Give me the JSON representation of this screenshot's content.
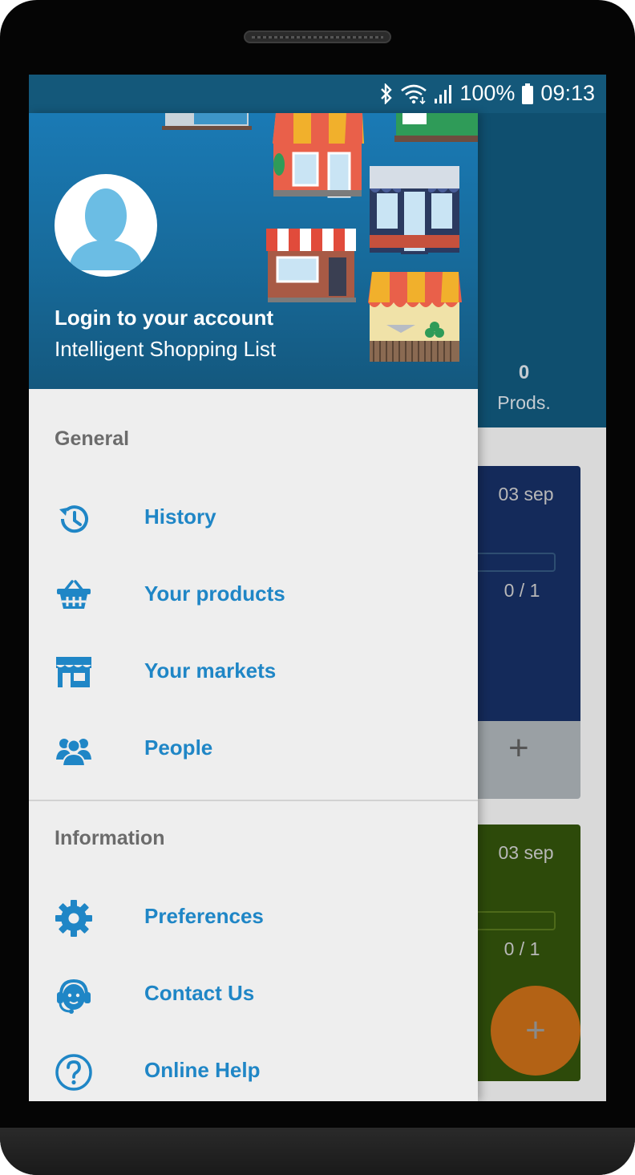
{
  "status_bar": {
    "battery_percent": "100%",
    "time": "09:13",
    "icons": [
      "bluetooth-icon",
      "wifi-icon",
      "signal-icon",
      "battery-icon"
    ]
  },
  "background_app": {
    "products_count": "0",
    "products_label": "Prods.",
    "lists": [
      {
        "date": "03 sep",
        "progress": "0 / 1",
        "color": "#142a5a"
      },
      {
        "date": "03 sep",
        "progress": "0 / 1",
        "color": "#2d4a0a"
      }
    ],
    "add_list_label": "+",
    "fab_label": "+"
  },
  "drawer": {
    "header": {
      "login_text": "Login to your account",
      "app_name": "Intelligent Shopping List",
      "avatar_icon": "user-avatar-icon"
    },
    "sections": [
      {
        "title": "General",
        "items": [
          {
            "label": "History",
            "icon": "history-icon"
          },
          {
            "label": "Your products",
            "icon": "basket-icon"
          },
          {
            "label": "Your markets",
            "icon": "store-icon"
          },
          {
            "label": "People",
            "icon": "people-icon"
          }
        ]
      },
      {
        "title": "Information",
        "items": [
          {
            "label": "Preferences",
            "icon": "gear-icon"
          },
          {
            "label": "Contact Us",
            "icon": "support-agent-icon"
          },
          {
            "label": "Online Help",
            "icon": "help-icon"
          }
        ]
      }
    ]
  },
  "colors": {
    "accent": "#1f86c6",
    "status_bar": "#14587a",
    "drawer_bg": "#eeeeee",
    "fab": "#b36215"
  }
}
